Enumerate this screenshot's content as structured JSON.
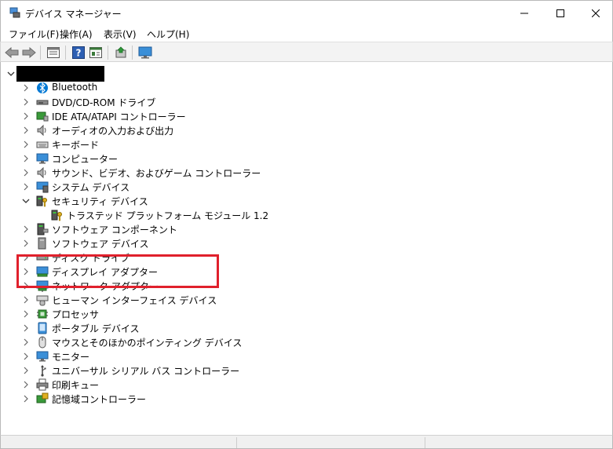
{
  "window": {
    "title": "デバイス マネージャー"
  },
  "menu": [
    {
      "label": "ファイル(F)"
    },
    {
      "label": "操作(A)"
    },
    {
      "label": "表示(V)"
    },
    {
      "label": "ヘルプ(H)"
    }
  ],
  "toolbar": {
    "buttons": [
      "back-icon",
      "forward-icon",
      "properties-pane-icon",
      "help-icon",
      "view-icon",
      "update-driver-icon",
      "monitor-scan-icon"
    ]
  },
  "tree": {
    "categories": [
      {
        "label": "Bluetooth",
        "icon": "bluetooth-icon"
      },
      {
        "label": "DVD/CD-ROM ドライブ",
        "icon": "dvd-drive-icon"
      },
      {
        "label": "IDE ATA/ATAPI コントローラー",
        "icon": "ide-controller-icon"
      },
      {
        "label": "オーディオの入力および出力",
        "icon": "speaker-icon"
      },
      {
        "label": "キーボード",
        "icon": "keyboard-icon"
      },
      {
        "label": "コンピューター",
        "icon": "computer-icon"
      },
      {
        "label": "サウンド、ビデオ、およびゲーム コントローラー",
        "icon": "speaker-icon"
      },
      {
        "label": "システム デバイス",
        "icon": "system-device-icon"
      },
      {
        "label": "セキュリティ デバイス",
        "icon": "security-key-icon",
        "expanded": true,
        "children": [
          {
            "label": "トラステッド プラットフォーム モジュール 1.2",
            "icon": "security-key-icon"
          }
        ]
      },
      {
        "label": "ソフトウェア コンポーネント",
        "icon": "software-component-icon"
      },
      {
        "label": "ソフトウェア デバイス",
        "icon": "software-device-icon"
      },
      {
        "label": "ディスク ドライブ",
        "icon": "disk-drive-icon"
      },
      {
        "label": "ディスプレイ アダプター",
        "icon": "display-adapter-icon"
      },
      {
        "label": "ネットワーク アダプター",
        "icon": "network-adapter-icon"
      },
      {
        "label": "ヒューマン インターフェイス デバイス",
        "icon": "hid-icon"
      },
      {
        "label": "プロセッサ",
        "icon": "processor-icon"
      },
      {
        "label": "ポータブル デバイス",
        "icon": "portable-device-icon"
      },
      {
        "label": "マウスとそのほかのポインティング デバイス",
        "icon": "mouse-icon"
      },
      {
        "label": "モニター",
        "icon": "monitor-icon"
      },
      {
        "label": "ユニバーサル シリアル バス コントローラー",
        "icon": "usb-icon"
      },
      {
        "label": "印刷キュー",
        "icon": "printer-icon"
      },
      {
        "label": "記憶域コントローラー",
        "icon": "storage-controller-icon"
      }
    ]
  },
  "colors": {
    "highlight": "#e0202c",
    "accent": "#0078d4"
  }
}
